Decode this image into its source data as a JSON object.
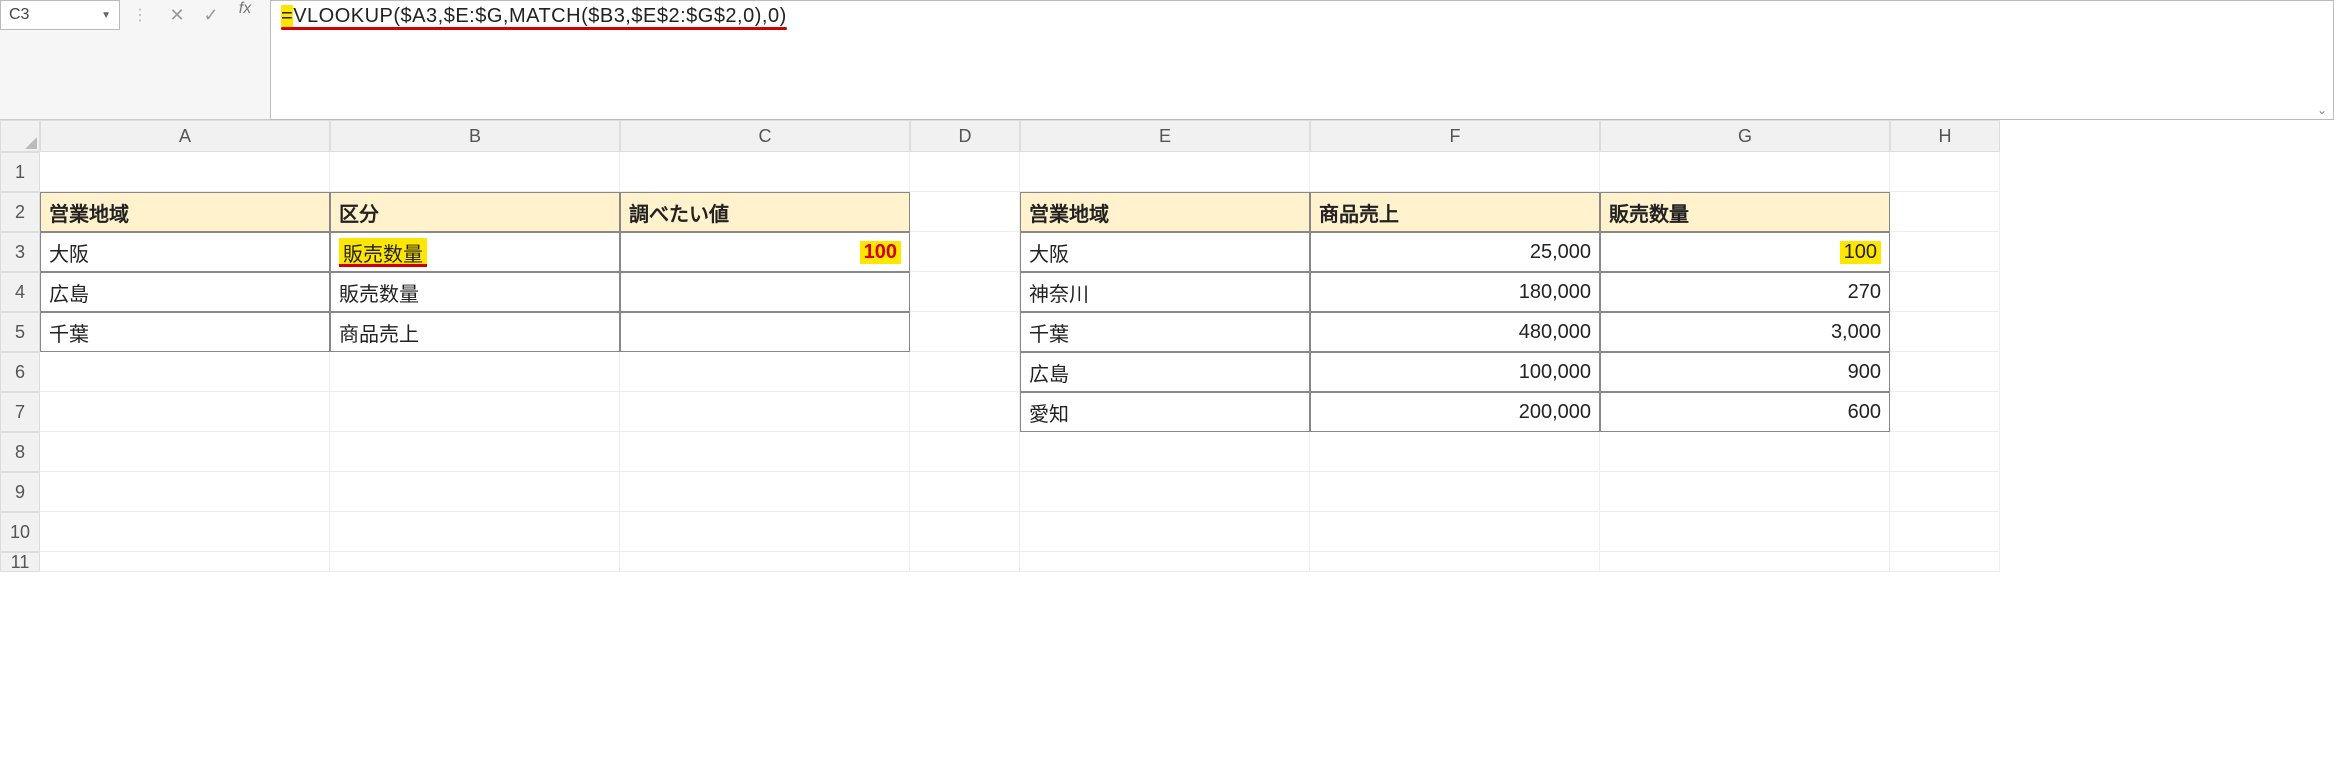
{
  "name_box": {
    "value": "C3"
  },
  "formula_bar": {
    "fx_label": "fx",
    "formula": "=VLOOKUP($A3,$E:$G,MATCH($B3,$E$2:$G$2,0),0)",
    "formula_prefix": "=",
    "formula_body": "VLOOKUP($A3,$E:$G,MATCH($B3,$E$2:$G$2,0),0)"
  },
  "columns": [
    "A",
    "B",
    "C",
    "D",
    "E",
    "F",
    "G",
    "H"
  ],
  "rows_shown": [
    "1",
    "2",
    "3",
    "4",
    "5",
    "6",
    "7",
    "8",
    "9",
    "10",
    "11"
  ],
  "left_table": {
    "headers": {
      "A": "営業地域",
      "B": "区分",
      "C": "調べたい値"
    },
    "rows": [
      {
        "A": "大阪",
        "B": "販売数量",
        "C": "100"
      },
      {
        "A": "広島",
        "B": "販売数量",
        "C": ""
      },
      {
        "A": "千葉",
        "B": "商品売上",
        "C": ""
      }
    ]
  },
  "right_table": {
    "headers": {
      "E": "営業地域",
      "F": "商品売上",
      "G": "販売数量"
    },
    "rows": [
      {
        "E": "大阪",
        "F": "25,000",
        "G": "100"
      },
      {
        "E": "神奈川",
        "F": "180,000",
        "G": "270"
      },
      {
        "E": "千葉",
        "F": "480,000",
        "G": "3,000"
      },
      {
        "E": "広島",
        "F": "100,000",
        "G": "900"
      },
      {
        "E": "愛知",
        "F": "200,000",
        "G": "600"
      }
    ]
  },
  "highlights": {
    "B3_underline_yellow": true,
    "C3_yellow_red": true,
    "G3_yellow": true,
    "formula_underline_red": true
  }
}
